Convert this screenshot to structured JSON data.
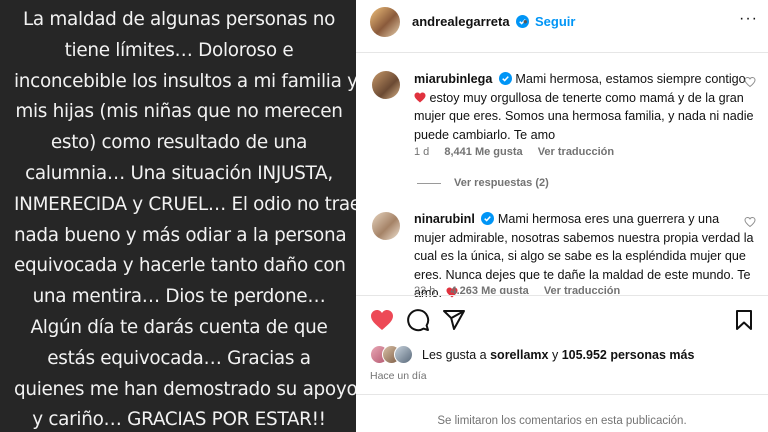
{
  "story": {
    "lines": [
      "La maldad de algunas personas no",
      "tiene límites… Doloroso e",
      "inconcebible los insultos a mi familia y",
      "mis hijas (mis niñas que no merecen",
      "esto) como resultado de una",
      "calumnia… Una situación INJUSTA,",
      "INMERECIDA y CRUEL… El odio no trae",
      "nada bueno y más odiar a la persona",
      "equivocada y hacerle tanto daño con",
      "una mentira… Dios te perdone…",
      "Algún día te darás cuenta de que",
      "estás equivocada… Gracias  a",
      "quienes me han demostrado su apoyo",
      "y cariño… GRACIAS POR ESTAR!!"
    ]
  },
  "header": {
    "username": "andrealegarreta",
    "separator": "•",
    "follow_label": "Seguir",
    "more": "···"
  },
  "comments": [
    {
      "username": "miarubinlega",
      "text": "Mami hermosa, estamos siempre contigo",
      "text_cont": "estoy muy orgullosa de tenerte como mamá y de la gran mujer que eres. Somos una hermosa familia, y nada ni nadie puede cambiarlo. Te amo",
      "age": "1 d",
      "likes": "8,441 Me gusta",
      "translate": "Ver traducción",
      "replies": "Ver respuestas (2)"
    },
    {
      "username": "ninarubinl",
      "text": "Mami hermosa eres una guerrera y una mujer admirable, nosotras sabemos nuestra propia verdad la cual es la única, si algo se sabe es la espléndida mujer que eres. Nunca dejes que te dañe la maldad de este mundo. Te amo.",
      "age": "23 h",
      "likes": "4,263 Me gusta",
      "translate": "Ver traducción"
    }
  ],
  "likes": {
    "prefix": "Les gusta a ",
    "user": "sorellamx",
    "middle": " y ",
    "count": "105.952 personas más"
  },
  "posted": "Hace un día",
  "comments_limited": "Se limitaron los comentarios en esta publicación.",
  "colors": {
    "story_bg": "#262626",
    "accent_blue": "#0095f6",
    "heart_red": "#ed4956"
  }
}
